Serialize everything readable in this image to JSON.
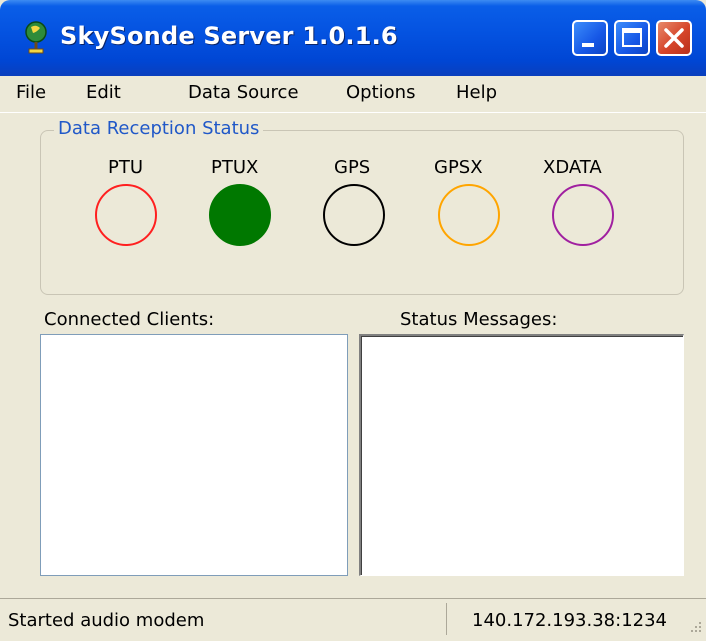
{
  "window": {
    "title": "SkySonde Server 1.0.1.6",
    "icon": "globe-icon"
  },
  "menu": {
    "items": [
      "File",
      "Edit",
      "Data Source",
      "Options",
      "Help"
    ]
  },
  "reception": {
    "title": "Data Reception Status",
    "indicators": [
      {
        "label": "PTU",
        "color": "#ff2020",
        "filled": false
      },
      {
        "label": "PTUX",
        "color": "#007800",
        "filled": true
      },
      {
        "label": "GPS",
        "color": "#000000",
        "filled": false
      },
      {
        "label": "GPSX",
        "color": "#ffa500",
        "filled": false
      },
      {
        "label": "XDATA",
        "color": "#a020a0",
        "filled": false
      }
    ]
  },
  "clients": {
    "label": "Connected Clients:"
  },
  "messages": {
    "label": "Status Messages:"
  },
  "statusbar": {
    "left": "Started audio modem",
    "right": "140.172.193.38:1234"
  }
}
